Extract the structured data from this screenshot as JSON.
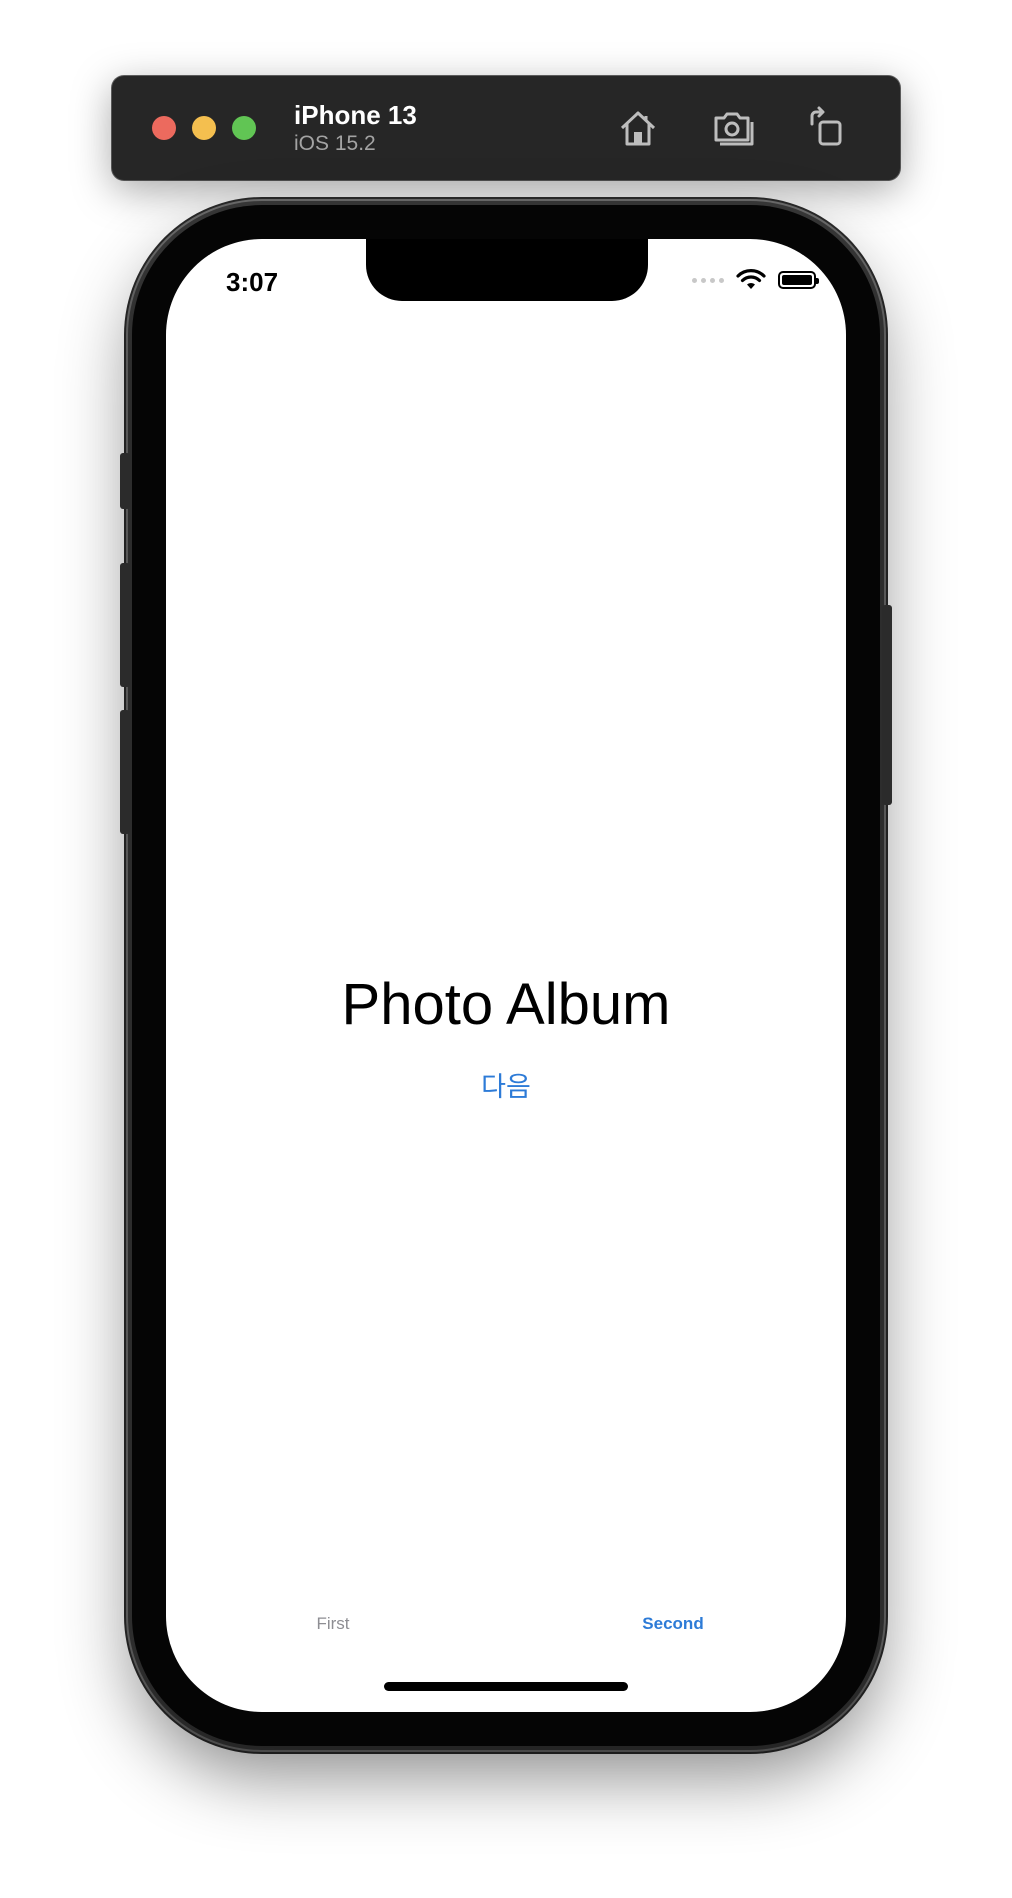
{
  "simulator": {
    "device_name": "iPhone 13",
    "os_version": "iOS 15.2",
    "buttons": [
      {
        "icon": "home-icon"
      },
      {
        "icon": "screenshot-icon"
      },
      {
        "icon": "rotate-icon"
      }
    ],
    "colors": {
      "close": "#ec6a5e",
      "minimize": "#f4bf4f",
      "zoom": "#61c554"
    }
  },
  "status_bar": {
    "time": "3:07"
  },
  "main": {
    "title": "Photo Album",
    "next_button": "다음"
  },
  "tab_bar": {
    "tabs": [
      {
        "label": "First",
        "selected": false
      },
      {
        "label": "Second",
        "selected": true
      }
    ]
  },
  "colors": {
    "accent": "#2d7bd7",
    "inactive": "#8e8e93"
  }
}
